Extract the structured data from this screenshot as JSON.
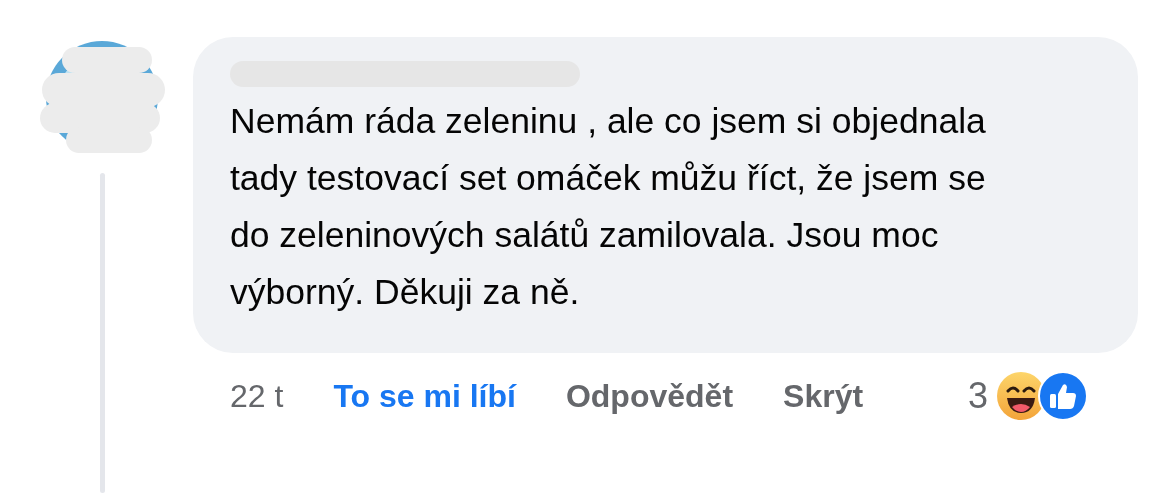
{
  "comment": {
    "text": "Nemám ráda zeleninu , ale co jsem si objednala tady testovací set omáček můžu říct, že jsem se do zeleninových salátů zamilovala. Jsou moc výborný. Děkuji za ně.",
    "time": "22 t",
    "actions": [
      {
        "label": "To se mi líbí",
        "selected": true
      },
      {
        "label": "Odpovědět",
        "selected": false
      },
      {
        "label": "Skrýt",
        "selected": false
      }
    ],
    "reactions": {
      "count": "3",
      "icons": [
        {
          "kind": "haha"
        },
        {
          "kind": "like"
        }
      ]
    }
  }
}
